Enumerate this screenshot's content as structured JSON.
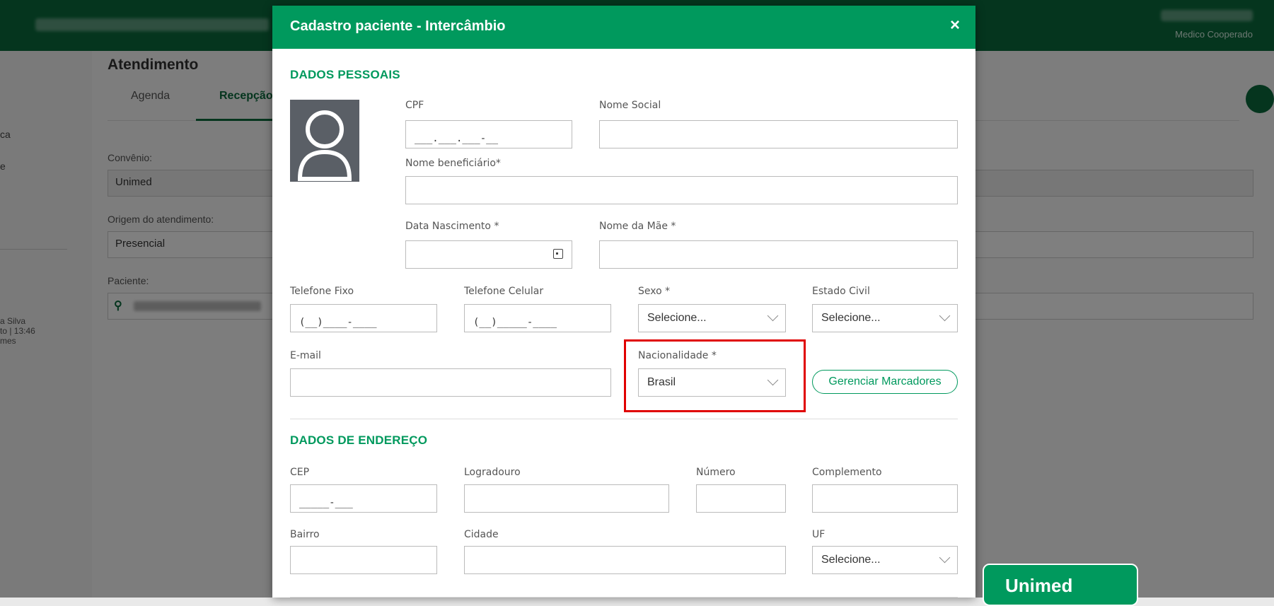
{
  "background": {
    "topbar": {
      "user_role": "Medico Cooperado"
    },
    "leftnav": {
      "items": [
        "ca",
        "e"
      ],
      "patient_lines": [
        "a Silva",
        "to | 13:46",
        "mes"
      ]
    },
    "main": {
      "title": "Atendimento",
      "tabs": [
        "Agenda",
        "Recepção"
      ],
      "convenio_label": "Convênio:",
      "convenio_value": "Unimed",
      "origem_label": "Origem do atendimento:",
      "origem_value": "Presencial",
      "paciente_label": "Paciente:"
    }
  },
  "modal": {
    "title": "Cadastro paciente - Intercâmbio",
    "close_symbol": "×",
    "personal": {
      "section_title": "DADOS PESSOAIS",
      "cpf_label": "CPF",
      "cpf_mask": "___.___.___-__",
      "nome_social_label": "Nome Social",
      "nome_beneficiario_label": "Nome beneficiário*",
      "data_nascimento_label": "Data Nascimento *",
      "nome_mae_label": "Nome da Mãe *",
      "telefone_fixo_label": "Telefone Fixo",
      "telefone_fixo_mask": "(__)____-____",
      "telefone_celular_label": "Telefone Celular",
      "telefone_celular_mask": "(__)_____-____",
      "sexo_label": "Sexo *",
      "sexo_value": "Selecione...",
      "estado_civil_label": "Estado Civil",
      "estado_civil_value": "Selecione...",
      "email_label": "E-mail",
      "nacionalidade_label": "Nacionalidade *",
      "nacionalidade_value": "Brasil",
      "marcadores_button": "Gerenciar Marcadores"
    },
    "address": {
      "section_title": "DADOS DE ENDEREÇO",
      "cep_label": "CEP",
      "cep_mask": "_____-___",
      "logradouro_label": "Logradouro",
      "numero_label": "Número",
      "complemento_label": "Complemento",
      "bairro_label": "Bairro",
      "cidade_label": "Cidade",
      "uf_label": "UF",
      "uf_value": "Selecione..."
    }
  },
  "brand": {
    "logo_text": "Unimed"
  },
  "colors": {
    "primary": "#00995d",
    "dark_green": "#0a6b3c",
    "highlight": "#e00000"
  }
}
